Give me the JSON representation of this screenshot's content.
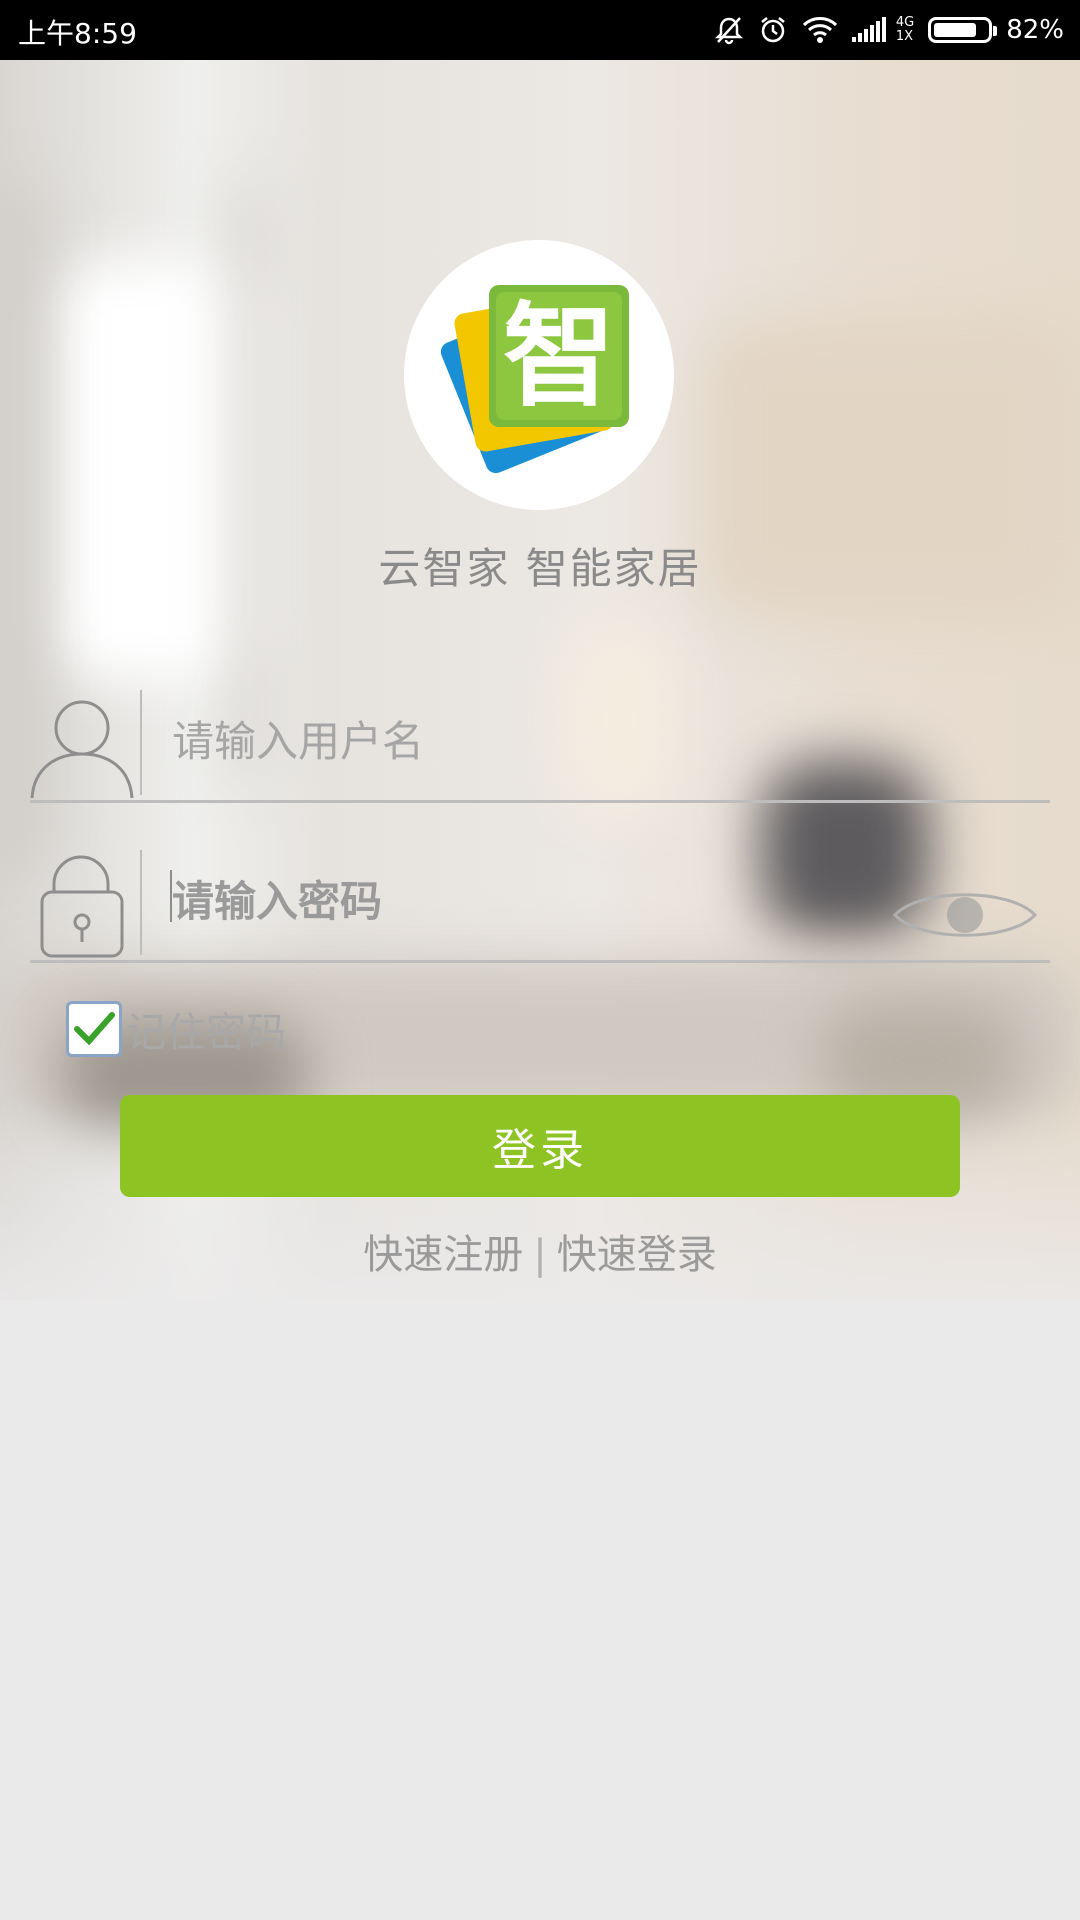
{
  "status_bar": {
    "time": "上午8:59",
    "network_top": "4G",
    "network_bottom": "1X",
    "battery_percent_text": "82%",
    "battery_level": 0.82
  },
  "app": {
    "title": "云智家 智能家居",
    "logo_glyph": "智"
  },
  "login": {
    "username_placeholder": "请输入用户名",
    "password_placeholder": "请输入密码",
    "remember_label": "记住密码",
    "remember_checked": true,
    "login_label": "登录",
    "register_link": "快速注册",
    "quick_login_link": "快速登录",
    "link_divider": "|"
  },
  "colors": {
    "accent": "#8dc322",
    "checkmark": "#3aa12a"
  }
}
